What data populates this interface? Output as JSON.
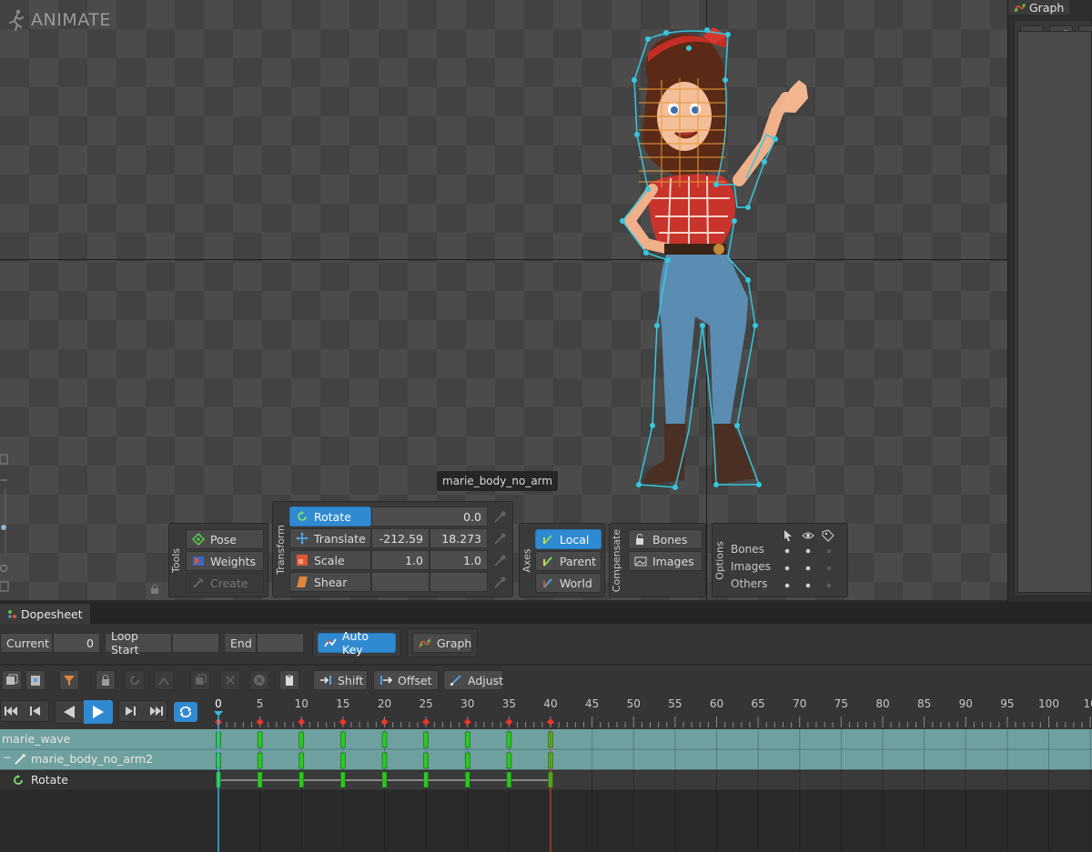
{
  "viewport": {
    "mode_label": "ANIMATE",
    "selected_bone_tag": "marie_body_no_arm"
  },
  "tools": {
    "title": "Tools",
    "pose": "Pose",
    "weights": "Weights",
    "create": "Create"
  },
  "transform": {
    "title": "Transform",
    "rotate": {
      "label": "Rotate",
      "value": "0.0"
    },
    "translate": {
      "label": "Translate",
      "x": "-212.59",
      "y": "18.273"
    },
    "scale": {
      "label": "Scale",
      "x": "1.0",
      "y": "1.0"
    },
    "shear": {
      "label": "Shear"
    }
  },
  "axes": {
    "title": "Axes",
    "local": "Local",
    "parent": "Parent",
    "world": "World"
  },
  "compensate": {
    "title": "Compensate",
    "bones": "Bones",
    "images": "Images"
  },
  "options": {
    "title": "Options",
    "rows": [
      "Bones",
      "Images",
      "Others"
    ]
  },
  "graph_panel": {
    "title": "Graph"
  },
  "dopesheet": {
    "tab": "Dopesheet",
    "current_label": "Current",
    "current_value": "0",
    "loop_start_label": "Loop Start",
    "loop_start_value": "",
    "end_label": "End",
    "end_value": "",
    "auto_key": "Auto Key",
    "graph_button": "Graph",
    "shift": "Shift",
    "offset": "Offset",
    "adjust": "Adjust",
    "ruler_labels": [
      "0",
      "5",
      "10",
      "15",
      "20",
      "25",
      "30",
      "35",
      "40",
      "45",
      "50",
      "55",
      "60",
      "65",
      "70",
      "75",
      "80",
      "85",
      "90",
      "95",
      "100",
      "10"
    ],
    "keyframes": [
      0,
      5,
      10,
      15,
      20,
      25,
      30,
      35,
      40
    ],
    "tracks": [
      {
        "label": "marie_wave"
      },
      {
        "label": "marie_body_no_arm2"
      },
      {
        "label": "Rotate"
      }
    ]
  },
  "colors": {
    "accent_blue": "#2f8ad1",
    "track_teal": "#6fa0a0",
    "keyframe_green": "#29c91e",
    "key_diamond": "#e5392a",
    "playhead": "#38b8e8"
  }
}
